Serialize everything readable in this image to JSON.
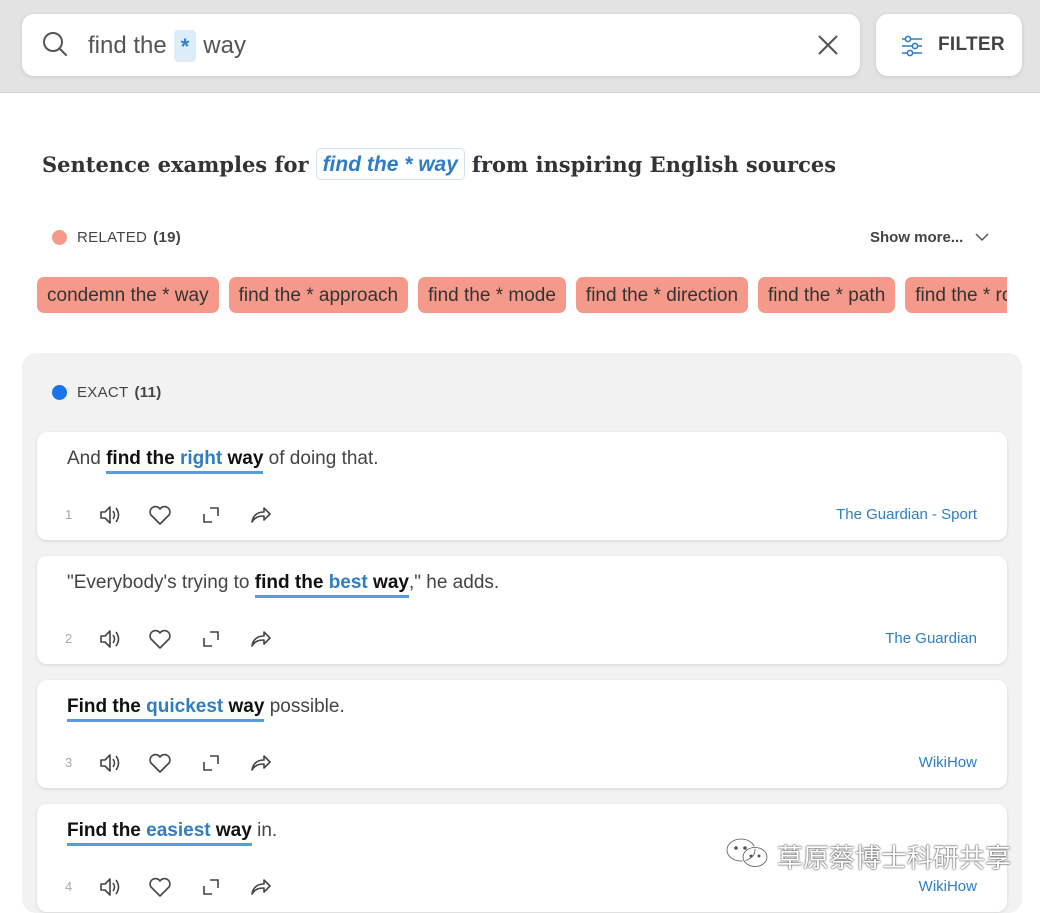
{
  "search": {
    "query_before": "find the",
    "wildcard": "*",
    "query_after": "way"
  },
  "filter": {
    "label": "FILTER"
  },
  "heading": {
    "prefix": "Sentence examples for",
    "phrase": "find the * way",
    "suffix": "from inspiring English sources"
  },
  "related": {
    "label": "RELATED",
    "count": "(19)",
    "color": "#f59a8a",
    "show_more": "Show more...",
    "chips": [
      "condemn the * way",
      "find the * approach",
      "find the * mode",
      "find the * direction",
      "find the * path",
      "find the * route"
    ]
  },
  "exact": {
    "label": "EXACT",
    "count": "(11)",
    "color": "#1a73e8",
    "examples": [
      {
        "num": "1",
        "pre": "And ",
        "phrase_a": "find the ",
        "word": "right",
        "phrase_b": " way",
        "post": " of doing that.",
        "source": "The Guardian - Sport"
      },
      {
        "num": "2",
        "pre": "\"Everybody's trying to ",
        "phrase_a": "find the ",
        "word": "best",
        "phrase_b": " way",
        "post": ",\" he adds.",
        "source": "The Guardian"
      },
      {
        "num": "3",
        "pre": "",
        "phrase_a": "Find the ",
        "word": "quickest",
        "phrase_b": " way",
        "post": " possible.",
        "source": "WikiHow"
      },
      {
        "num": "4",
        "pre": "",
        "phrase_a": "Find the ",
        "word": "easiest",
        "phrase_b": " way",
        "post": " in.",
        "source": "WikiHow"
      }
    ]
  },
  "icons": {
    "search": "search-icon",
    "clear": "close-icon",
    "filter": "sliders-icon",
    "chevron": "chevron-down-icon",
    "speaker": "speaker-icon",
    "heart": "heart-icon",
    "expand": "expand-icon",
    "share": "share-icon"
  },
  "watermark": {
    "text": "草原蔡博士科研共享"
  }
}
